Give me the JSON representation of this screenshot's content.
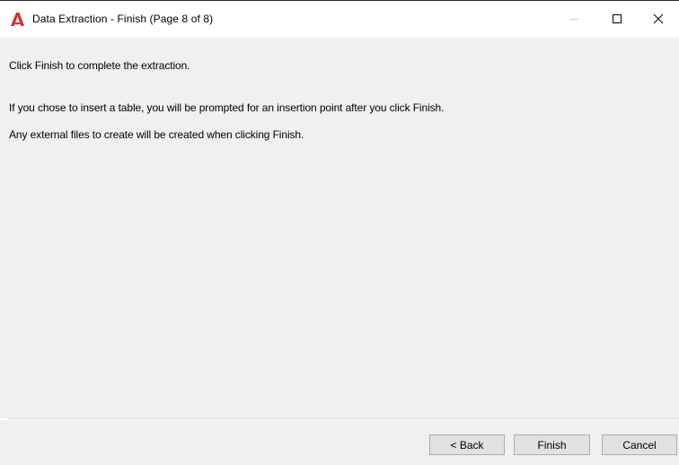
{
  "window": {
    "title": "Data Extraction - Finish (Page 8 of 8)",
    "app_icon": "autocad-a-icon",
    "accent_color": "#d32f2f"
  },
  "titlebar_controls": {
    "minimize_icon": "minimize-icon",
    "maximize_icon": "maximize-icon",
    "close_icon": "close-icon"
  },
  "body": {
    "line1": "Click Finish to complete the extraction.",
    "line2": "If you chose to insert a table, you will be prompted for an insertion point after you click Finish.",
    "line3": "Any external files to create will be created when clicking Finish."
  },
  "buttons": {
    "back_label": "< Back",
    "finish_label": "Finish",
    "cancel_label": "Cancel"
  }
}
